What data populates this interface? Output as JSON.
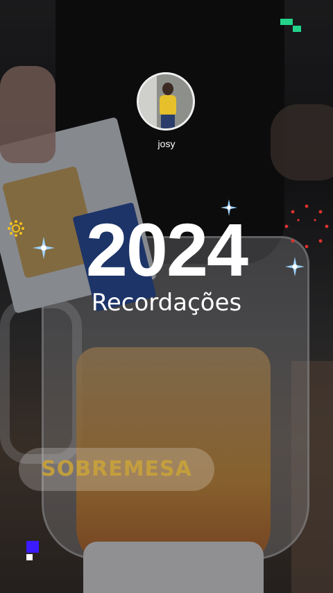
{
  "story": {
    "username": "josy",
    "year": "2024",
    "subtitle": "Recordações",
    "sticker_label": "SOBREMESA"
  },
  "icons": {
    "brand_top_right": "green-pixel-logo",
    "brand_bottom_left": "blue-pixel-logo",
    "decorations": [
      "sparkle-icon",
      "sun-icon",
      "dots-ring-icon"
    ]
  },
  "colors": {
    "brand_green": "#23d38a",
    "brand_blue": "#3b1bff",
    "sticker_text": "#c9a23a",
    "sparkle": "#9fd3ff",
    "dots": "#e0322e",
    "sun": "#f2c21b"
  }
}
